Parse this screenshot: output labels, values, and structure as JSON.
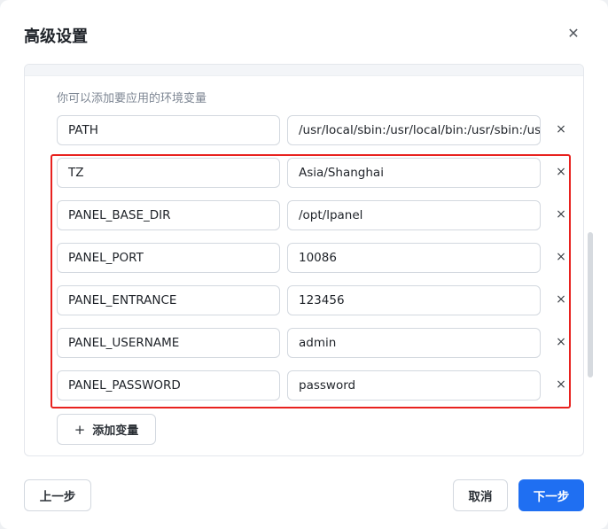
{
  "dialog": {
    "title": "高级设置",
    "close_icon": "close-icon"
  },
  "panel": {
    "hint": "你可以添加要应用的环境变量",
    "variables": [
      {
        "key": "PATH",
        "value": "/usr/local/sbin:/usr/local/bin:/usr/sbin:/usr"
      },
      {
        "key": "TZ",
        "value": "Asia/Shanghai"
      },
      {
        "key": "PANEL_BASE_DIR",
        "value": "/opt/lpanel"
      },
      {
        "key": "PANEL_PORT",
        "value": "10086"
      },
      {
        "key": "PANEL_ENTRANCE",
        "value": "123456"
      },
      {
        "key": "PANEL_USERNAME",
        "value": "admin"
      },
      {
        "key": "PANEL_PASSWORD",
        "value": "password"
      }
    ],
    "delete_symbol": "×",
    "add_button": {
      "icon": "plus-icon",
      "plus": "+",
      "label": "添加变量"
    }
  },
  "footer": {
    "prev_label": "上一步",
    "cancel_label": "取消",
    "next_label": "下一步"
  },
  "colors": {
    "primary": "#1f6ff2",
    "highlight": "#e8221f"
  }
}
